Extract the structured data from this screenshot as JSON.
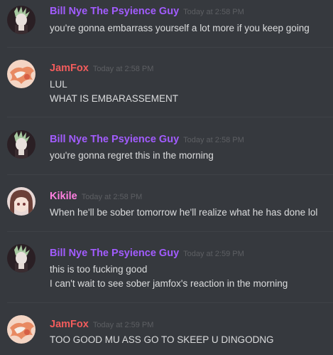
{
  "colors": {
    "background": "#36393e",
    "bill_name": "#a25cff",
    "jamfox_name": "#f25c5c",
    "kikile_name": "#ff7fe0",
    "timestamp": "#5d5f63",
    "message_text": "#dcddde"
  },
  "messages": [
    {
      "author": "Bill Nye The Psyience Guy",
      "timestamp": "Today at 2:58 PM",
      "avatar": "bill-avatar",
      "lines": [
        "you're gonna embarrass yourself a lot more if you keep going"
      ]
    },
    {
      "author": "JamFox",
      "timestamp": "Today at 2:58 PM",
      "avatar": "jamfox-avatar",
      "lines": [
        "LUL",
        "WHAT IS EMBARASSEMENT"
      ]
    },
    {
      "author": "Bill Nye The Psyience Guy",
      "timestamp": "Today at 2:58 PM",
      "avatar": "bill-avatar",
      "lines": [
        "you're gonna regret this in the morning"
      ]
    },
    {
      "author": "Kikile",
      "timestamp": "Today at 2:58 PM",
      "avatar": "kikile-avatar",
      "lines": [
        "When he'll be sober tomorrow he'll realize what he has done lol"
      ]
    },
    {
      "author": "Bill Nye The Psyience Guy",
      "timestamp": "Today at 2:59 PM",
      "avatar": "bill-avatar",
      "lines": [
        "this is too fucking good",
        "I can't wait to see sober jamfox's reaction in the morning"
      ]
    },
    {
      "author": "JamFox",
      "timestamp": "Today at 2:59 PM",
      "avatar": "jamfox-avatar",
      "lines": [
        "TOO GOOD MU ASS GO TO SKEEP U DINGODNG"
      ]
    }
  ]
}
